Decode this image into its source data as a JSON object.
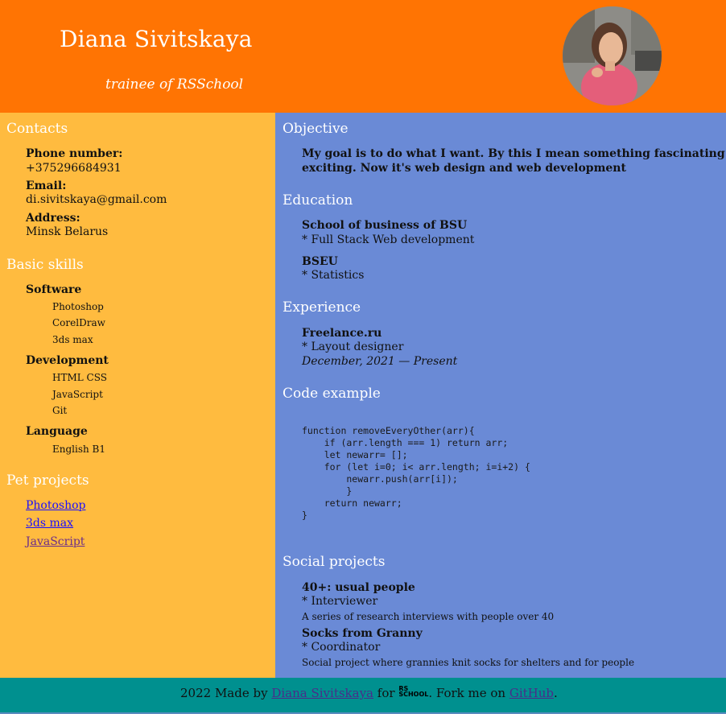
{
  "header": {
    "name": "Diana Sivitskaya",
    "subtitle": "trainee of RSSchool",
    "header_color": "#ff7403"
  },
  "contacts": {
    "heading": "Contacts",
    "phone_label": "Phone number:",
    "phone": "+375296684931",
    "email_label": "Email:",
    "email": "di.sivitskaya@gmail.com",
    "address_label": "Address:",
    "address": "Minsk Belarus"
  },
  "skills": {
    "heading": "Basic skills",
    "groups": [
      {
        "title": "Software",
        "items": [
          "Photoshop",
          "CorelDraw",
          "3ds max"
        ]
      },
      {
        "title": "Development",
        "items": [
          "HTML CSS",
          "JavaScript",
          "Git"
        ]
      },
      {
        "title": "Language",
        "items": [
          "English B1"
        ]
      }
    ]
  },
  "pet_projects": {
    "heading": "Pet projects",
    "links": [
      "Photoshop",
      "3ds max",
      "JavaScript"
    ]
  },
  "objective": {
    "heading": "Objective",
    "line1": "My goal is to do what I want. By this I mean something fascinating and",
    "line2": "exciting. Now it's web design and web development"
  },
  "education": {
    "heading": "Education",
    "items": [
      {
        "school": "School of business of BSU",
        "detail": "* Full Stack Web development"
      },
      {
        "school": "BSEU",
        "detail": "* Statistics"
      }
    ]
  },
  "experience": {
    "heading": "Experience",
    "company": "Freelance.ru",
    "role": "* Layout designer",
    "period": "December, 2021 — Present"
  },
  "code_example": {
    "heading": "Code example",
    "code": "function removeEveryOther(arr){\n    if (arr.length === 1) return arr;\n    let newarr= [];\n    for (let i=0; i< arr.length; i=i+2) {\n        newarr.push(arr[i]);\n        }\n    return newarr;\n}"
  },
  "social_projects": {
    "heading": "Social projects",
    "items": [
      {
        "title": "40+: usual people",
        "role": "* Interviewer",
        "desc": "A series of research interviews with people over 40"
      },
      {
        "title": "Socks from Granny",
        "role": "* Coordinator",
        "desc": "Social project where grannies knit socks for shelters and for people"
      }
    ]
  },
  "footer": {
    "made_by": "2022 Made by ",
    "author_link": "Diana Sivitskaya",
    "for_text": " for ",
    "logo_top": "RS",
    "logo_bottom": "SCHOOL",
    "fork_text": ". Fork me on ",
    "github_link": "GitHub",
    "end": "."
  },
  "colors": {
    "left_column": "#ffbb3f",
    "right_column": "#6a8ad6",
    "footer": "#00908f"
  }
}
